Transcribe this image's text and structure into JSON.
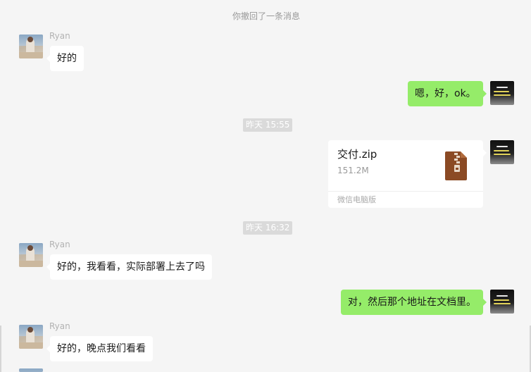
{
  "system": {
    "recall_notice": "你撤回了一条消息"
  },
  "timestamps": {
    "t1": "昨天 15:55",
    "t2": "昨天 16:32"
  },
  "contact": {
    "name": "Ryan"
  },
  "messages": {
    "m1": "好的",
    "m2": "嗯，好，ok。",
    "m4": "好的，我看看，实际部署上去了吗",
    "m5": "对，然后那个地址在文档里。",
    "m6": "好的，晚点我们看看"
  },
  "file": {
    "name": "交付.zip",
    "size": "151.2M",
    "source": "微信电脑版",
    "icon": "zip-file-icon"
  },
  "colors": {
    "background": "#f5f5f5",
    "incoming_bubble": "#ffffff",
    "outgoing_bubble": "#95ec69",
    "zip_icon": "#8b4a24"
  }
}
